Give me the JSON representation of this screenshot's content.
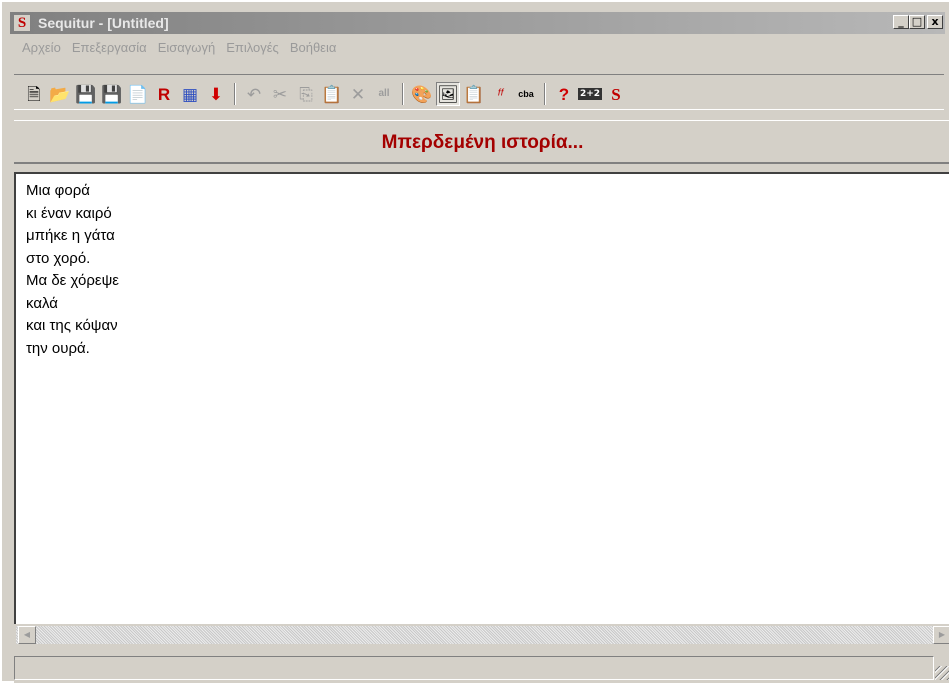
{
  "window": {
    "app_icon_letter": "S",
    "title": "Sequitur - [Untitled]",
    "controls": {
      "minimize": "_",
      "maximize": "□",
      "close": "x"
    }
  },
  "menu": {
    "items": [
      "Αρχείο",
      "Επεξεργασία",
      "Εισαγωγή",
      "Επιλογές",
      "Βοήθεια"
    ]
  },
  "toolbar": {
    "group1": [
      {
        "icon": "new-file-icon",
        "glyph": "🗎"
      },
      {
        "icon": "open-folder-icon",
        "glyph": "📂"
      },
      {
        "icon": "save-icon",
        "glyph": "💾"
      },
      {
        "icon": "save-as-icon",
        "glyph": "💾"
      },
      {
        "icon": "sentence-icon",
        "glyph": "📄"
      },
      {
        "icon": "r-marker-icon",
        "glyph": "R"
      },
      {
        "icon": "random-shuffle-icon",
        "glyph": "▦"
      },
      {
        "icon": "down-arrow-icon",
        "glyph": "⬇"
      }
    ],
    "group2": [
      {
        "icon": "undo-icon",
        "glyph": "↶"
      },
      {
        "icon": "cut-icon",
        "glyph": "✂"
      },
      {
        "icon": "copy-icon",
        "glyph": "⎘"
      },
      {
        "icon": "paste-icon",
        "glyph": "📋"
      },
      {
        "icon": "delete-icon",
        "glyph": "✕"
      },
      {
        "icon": "select-all-icon",
        "glyph": "all"
      }
    ],
    "group3": [
      {
        "icon": "palette-icon",
        "glyph": "🎨"
      },
      {
        "icon": "display-mode-icon",
        "glyph": "🖼"
      },
      {
        "icon": "document-list-icon",
        "glyph": "📋"
      },
      {
        "icon": "fonts-icon",
        "glyph": "ᶠᶠ"
      },
      {
        "icon": "reverse-text-icon",
        "glyph": "cba"
      }
    ],
    "group4": [
      {
        "icon": "help-icon",
        "glyph": "?"
      },
      {
        "icon": "math-icon",
        "glyph": "2+2"
      },
      {
        "icon": "sequitur-logo-icon",
        "glyph": "S"
      }
    ]
  },
  "heading": "Μπερδεμένη ιστορία...",
  "editor": {
    "lines": [
      "Μια φορά",
      "κι έναν καιρό",
      "μπήκε η γάτα",
      "στο χορό.",
      "Μα δε χόρεψε",
      "καλά",
      "και της κόψαν",
      "την ουρά."
    ]
  },
  "scrollbar": {
    "left_arrow": "◀",
    "right_arrow": "▶"
  },
  "status": {
    "text": ""
  }
}
